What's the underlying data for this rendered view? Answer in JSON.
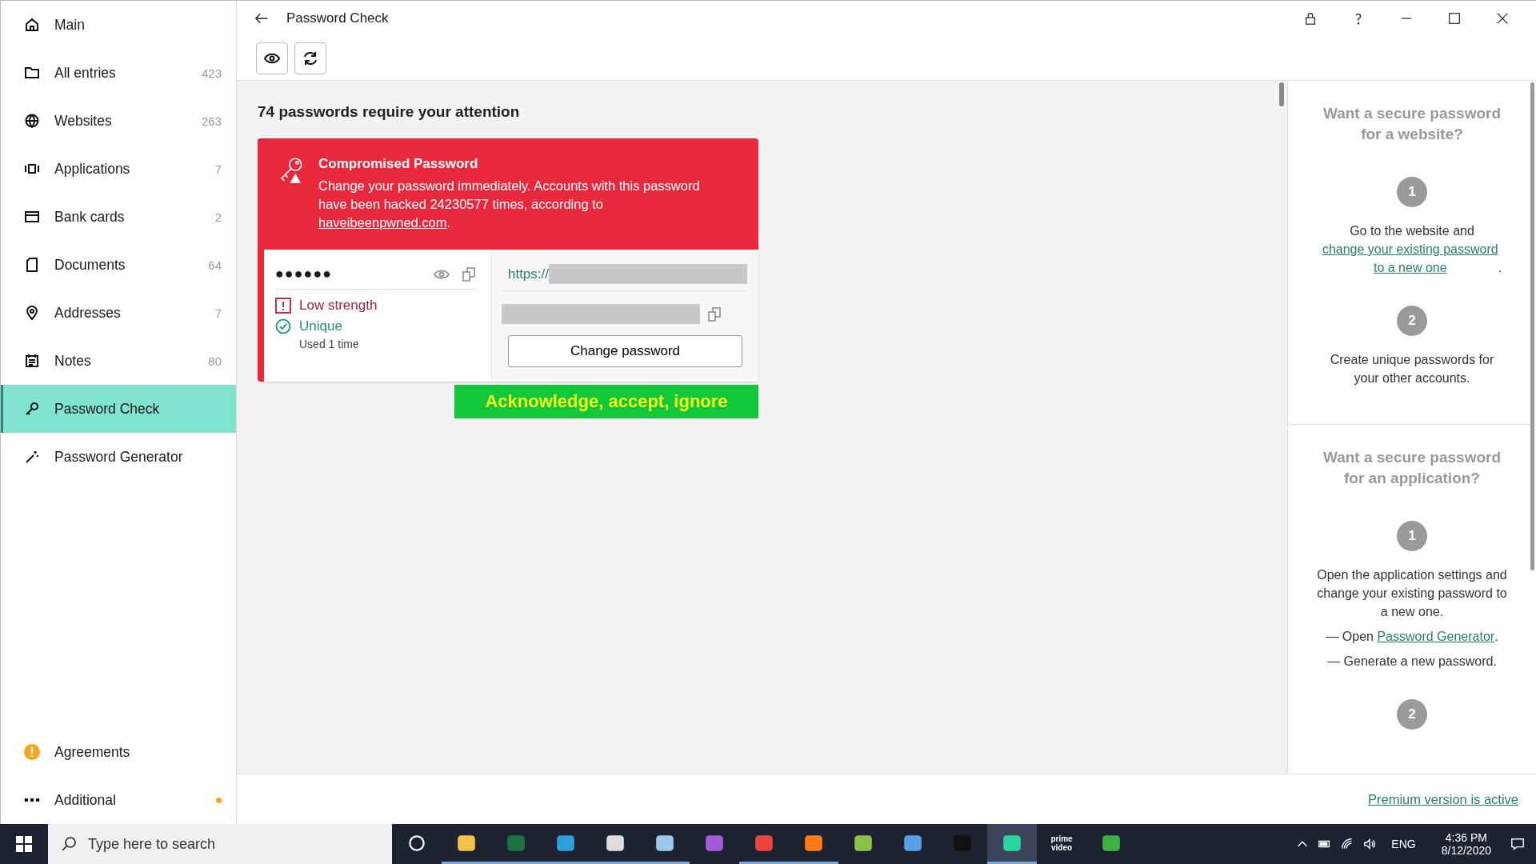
{
  "sidebar": {
    "items": [
      {
        "label": "Main",
        "selected": false
      },
      {
        "label": "All entries",
        "count": "423",
        "selected": false
      },
      {
        "label": "Websites",
        "count": "263",
        "selected": false
      },
      {
        "label": "Applications",
        "count": "7",
        "selected": false
      },
      {
        "label": "Bank cards",
        "count": "2",
        "selected": false
      },
      {
        "label": "Documents",
        "count": "64",
        "selected": false
      },
      {
        "label": "Addresses",
        "count": "7",
        "selected": false
      },
      {
        "label": "Notes",
        "count": "80",
        "selected": false
      },
      {
        "label": "Password Check",
        "selected": true
      },
      {
        "label": "Password Generator",
        "selected": false
      }
    ],
    "bottom_items": [
      {
        "label": "Agreements",
        "kind": "warning"
      },
      {
        "label": "Additional",
        "kind": "dot"
      }
    ]
  },
  "window": {
    "title": "Password Check"
  },
  "heading": "74 passwords require your attention",
  "alert": {
    "title": "Compromised Password",
    "message": "Change your password immediately. Accounts with this password have been hacked 24230577 times, according to ",
    "link": "haveibeenpwned.com",
    "after": ".",
    "password": "●●●●●●",
    "checks": [
      {
        "kind": "bad",
        "label": "Low strength"
      },
      {
        "kind": "good",
        "label": "Unique",
        "note": "Used 1 time"
      }
    ],
    "url_prefix": "https://",
    "button": "Change password"
  },
  "banner": "Acknowledge, accept, ignore",
  "tips": [
    {
      "title": "Want a secure password for a website?",
      "steps": [
        {
          "number": "1",
          "paragraphs": [
            {
              "text": "Go to the website and ",
              "link": "change your existing password to a new one",
              "after": "."
            }
          ]
        },
        {
          "number": "2",
          "paragraphs": [
            {
              "text": "Create unique passwords for your other accounts."
            }
          ]
        }
      ]
    },
    {
      "title": "Want a secure password for an application?",
      "steps": [
        {
          "number": "1",
          "paragraphs": [
            {
              "text": "Open the application settings and change your existing password to a new one."
            },
            {
              "text": "— Open ",
              "link": "Password Generator",
              "after": "."
            },
            {
              "text": "— Generate a new password."
            }
          ]
        },
        {
          "number": "2"
        }
      ]
    }
  ],
  "footer_link": "Premium version is active",
  "taskbar": {
    "search_placeholder": "Type here to search",
    "apps": [
      {
        "open": false,
        "selected": false
      },
      {
        "open": true,
        "selected": false
      },
      {
        "open": true,
        "selected": false
      },
      {
        "open": true,
        "selected": false
      },
      {
        "open": true,
        "selected": false
      },
      {
        "open": true,
        "selected": false
      },
      {
        "open": false,
        "selected": false
      },
      {
        "open": true,
        "selected": false
      },
      {
        "open": true,
        "selected": false
      },
      {
        "open": false,
        "selected": false
      },
      {
        "open": false,
        "selected": false
      },
      {
        "open": false,
        "selected": false
      },
      {
        "open": true,
        "selected": true
      },
      {
        "open": false,
        "selected": false,
        "label": "prime video"
      },
      {
        "open": false,
        "selected": false
      }
    ],
    "language": "ENG",
    "time": "4:36 PM",
    "date": "8/12/2020"
  }
}
